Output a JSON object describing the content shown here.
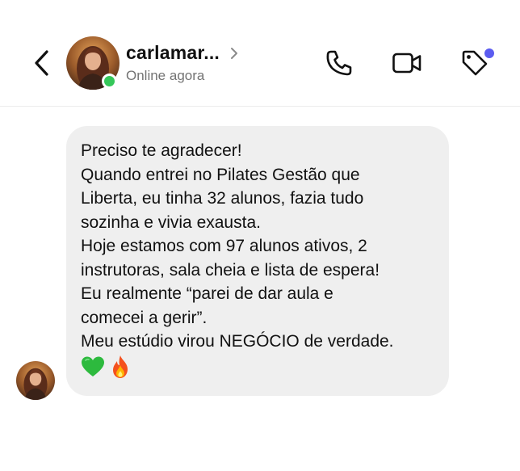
{
  "header": {
    "contact_name": "carlamar...",
    "status": "Online agora",
    "colors": {
      "online": "#35c759",
      "notification_dot": "#5b5cf0",
      "bubble": "#efefef"
    },
    "icons": [
      "back-chevron-icon",
      "chevron-right-icon",
      "phone-icon",
      "video-camera-icon",
      "tag-icon"
    ]
  },
  "message": {
    "lines": [
      "Preciso te agradecer!",
      "Quando entrei no Pilates Gestão que",
      "Liberta, eu tinha 32 alunos, fazia tudo",
      "sozinha e vivia exausta.",
      "Hoje estamos com 97 alunos ativos, 2",
      "instrutoras, sala cheia e lista de espera!",
      "Eu realmente “parei de dar aula e",
      "comecei a gerir”.",
      "Meu estúdio virou NEGÓCIO de verdade."
    ],
    "emojis": [
      "green-heart",
      "fire"
    ]
  }
}
